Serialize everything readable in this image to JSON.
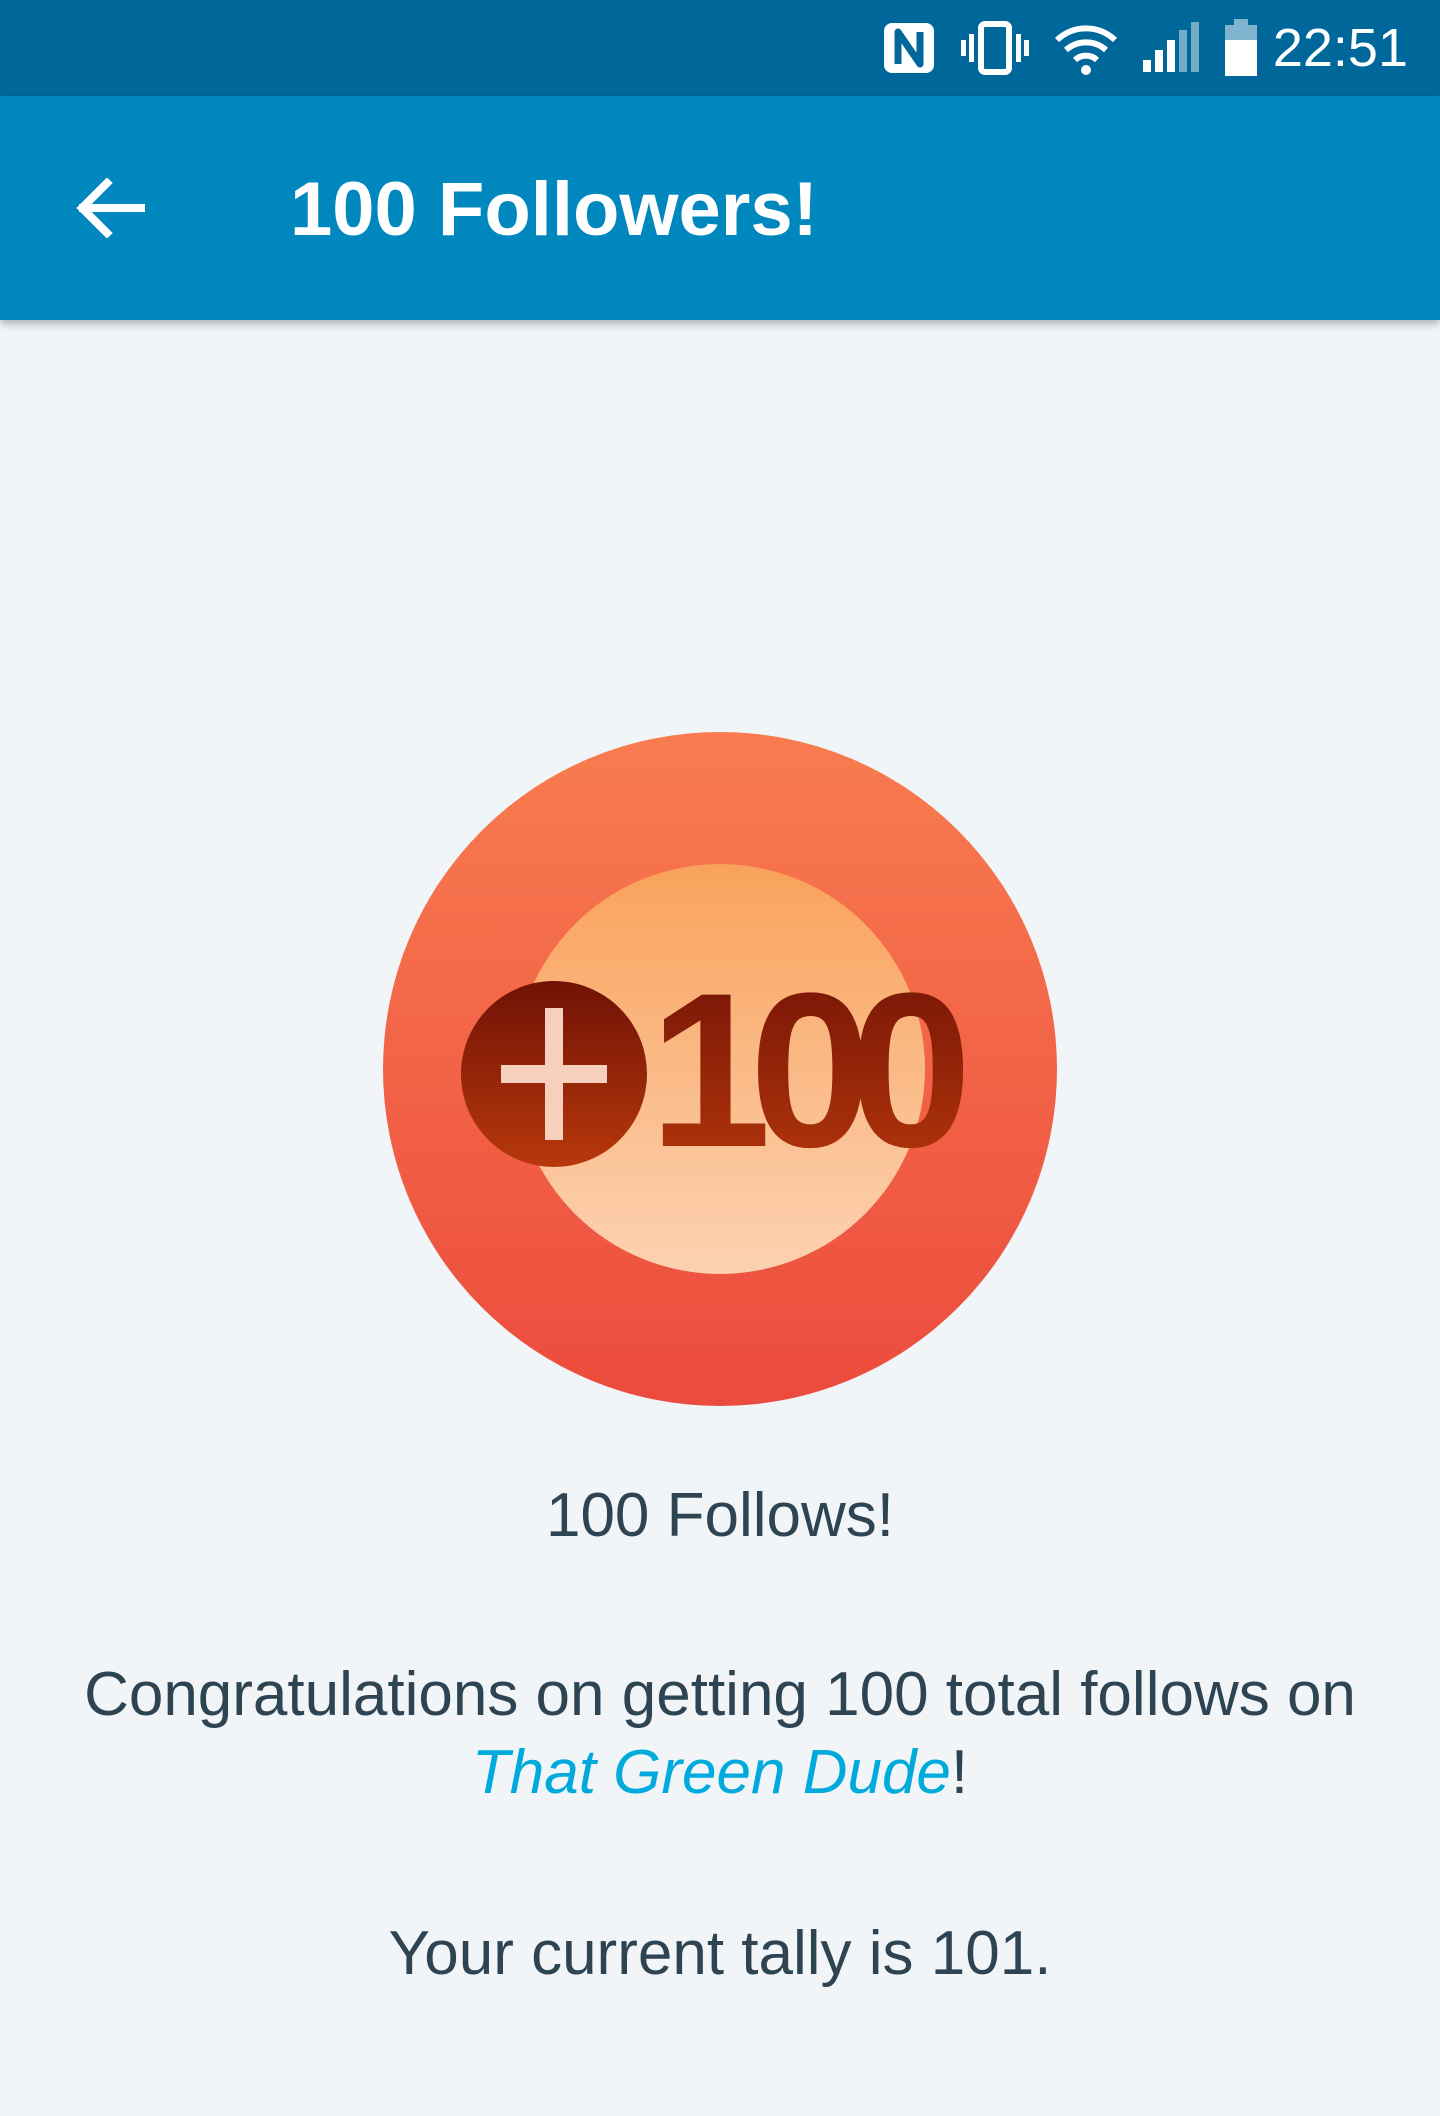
{
  "status_bar": {
    "time": "22:51",
    "icons": [
      "nfc-icon",
      "vibrate-icon",
      "wifi-icon",
      "signal-icon",
      "battery-icon"
    ],
    "background": "#00679b"
  },
  "app_bar": {
    "title": "100 Followers!",
    "back_icon": "arrow-left-icon",
    "background": "#0087be"
  },
  "badge": {
    "label": "+100",
    "icon": "plus-100-badge-icon",
    "colors": {
      "outer": "#f37150",
      "inner": "#fcc29f",
      "text": "#8a1a05"
    }
  },
  "achievement": {
    "title": "100 Follows!",
    "message_prefix": "Congratulations on getting 100 total follows on ",
    "site_name": "That Green Dude",
    "message_suffix": "!",
    "tally_text": "Your current tally is 101."
  },
  "colors": {
    "page_background": "#f2f5f8",
    "body_text": "#2e4453",
    "link": "#00aadc"
  }
}
